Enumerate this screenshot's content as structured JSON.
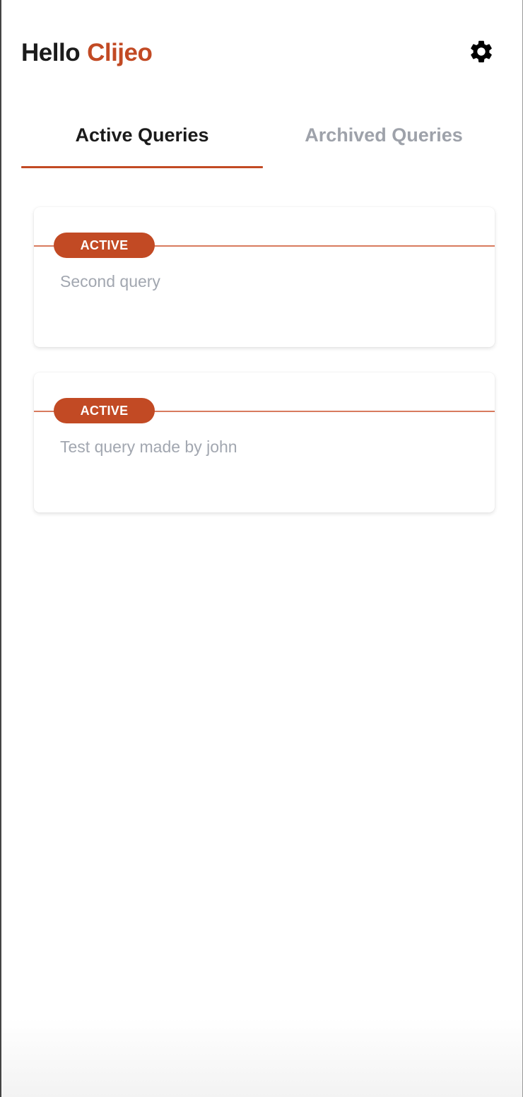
{
  "header": {
    "greeting": "Hello",
    "user_name": "Clijeo",
    "settings_icon": "gear-icon"
  },
  "tabs": [
    {
      "label": "Active Queries",
      "selected": true
    },
    {
      "label": "Archived Queries",
      "selected": false
    }
  ],
  "queries": [
    {
      "status": "ACTIVE",
      "text": "Second query"
    },
    {
      "status": "ACTIVE",
      "text": "Test query made by john"
    }
  ],
  "colors": {
    "accent": "#c24a24",
    "muted_text": "#a2a7b0",
    "inactive_tab": "#9ea2aa"
  }
}
